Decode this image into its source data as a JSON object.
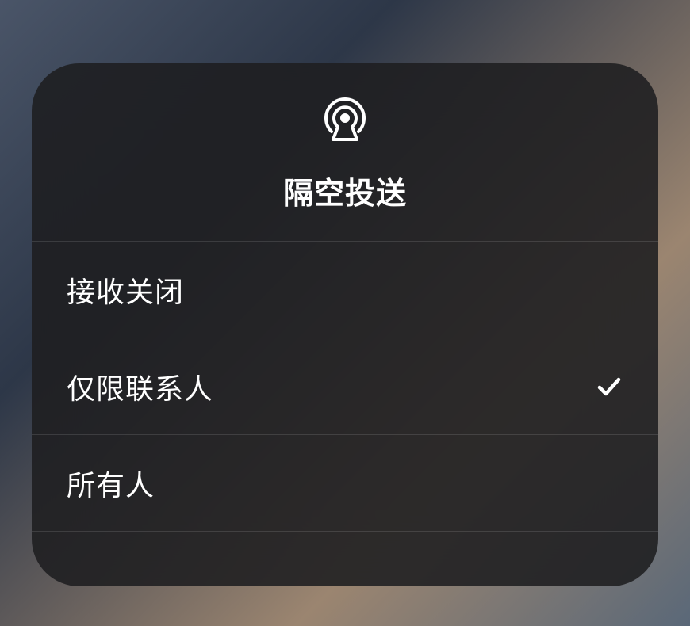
{
  "panel": {
    "title": "隔空投送",
    "icon_name": "airdrop-icon"
  },
  "options": [
    {
      "label": "接收关闭",
      "selected": false
    },
    {
      "label": "仅限联系人",
      "selected": true
    },
    {
      "label": "所有人",
      "selected": false
    }
  ]
}
